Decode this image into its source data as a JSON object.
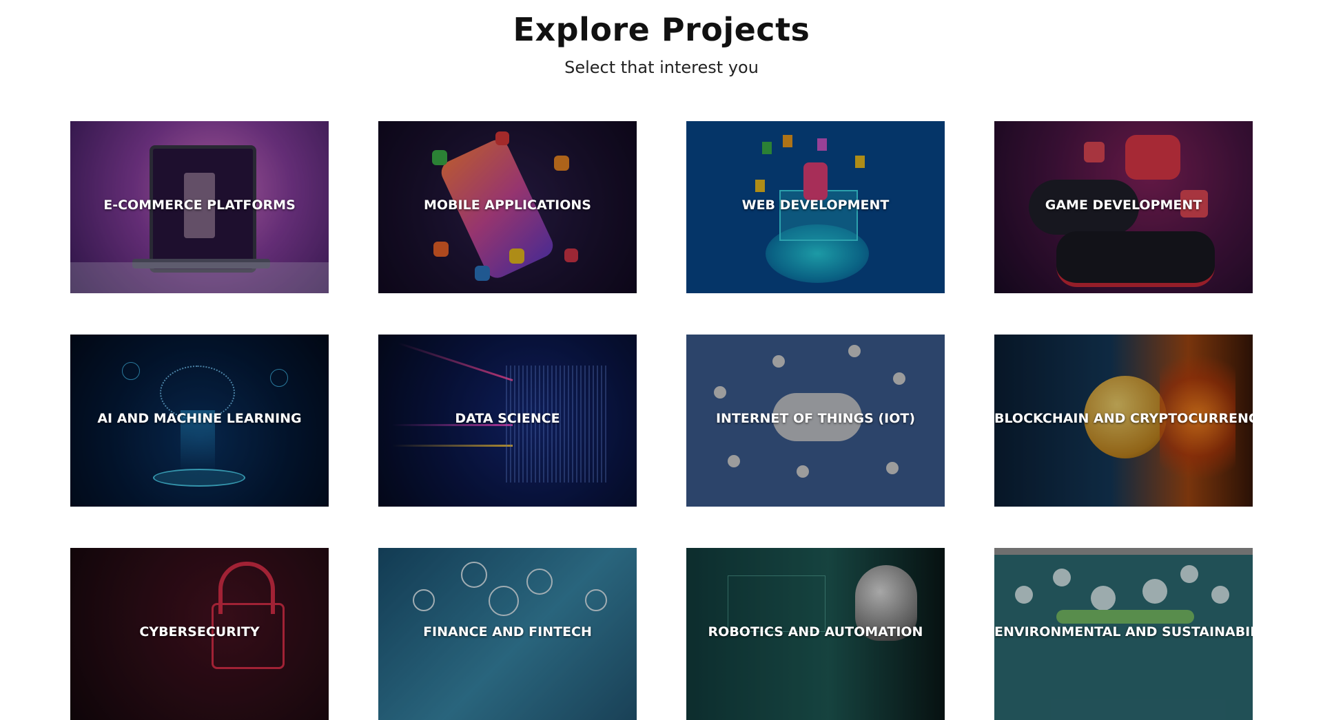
{
  "header": {
    "title": "Explore Projects",
    "subtitle": "Select that interest you"
  },
  "cards": [
    {
      "label": "E-COMMERCE PLATFORMS",
      "icon": "laptop-shopping-bag-icon",
      "colors": [
        "#7a3e9a",
        "#d86ac4",
        "#3b1f5c"
      ]
    },
    {
      "label": "MOBILE APPLICATIONS",
      "icon": "smartphone-apps-icon",
      "colors": [
        "#1f1537",
        "#2b1d47",
        "#130d24"
      ]
    },
    {
      "label": "WEB DEVELOPMENT",
      "icon": "developer-workstation-icon",
      "colors": [
        "#08468c",
        "#0d5aa8",
        "#063a74"
      ]
    },
    {
      "label": "GAME DEVELOPMENT",
      "icon": "gamepad-vr-icon",
      "colors": [
        "#3a0f33",
        "#7d2054",
        "#1a0b26"
      ]
    },
    {
      "label": "AI AND MACHINE LEARNING",
      "icon": "brain-circuit-icon",
      "colors": [
        "#03142e",
        "#06224a",
        "#020b1c"
      ]
    },
    {
      "label": "DATA SCIENCE",
      "icon": "data-streams-icon",
      "colors": [
        "#081233",
        "#10205a",
        "#050b22"
      ]
    },
    {
      "label": "INTERNET OF THINGS (IOT)",
      "icon": "cloud-network-icon",
      "colors": [
        "#3a5a8c",
        "#4a6ea3",
        "#2f4d7b"
      ]
    },
    {
      "label": "BLOCKCHAIN AND CRYPTOCURRENCY",
      "icon": "bitcoin-icon",
      "colors": [
        "#0b1c2e",
        "#7a3a0d",
        "#1c3a5a"
      ]
    },
    {
      "label": "CYBERSECURITY",
      "icon": "padlock-icon",
      "colors": [
        "#2a0d14",
        "#4a1020",
        "#14070c"
      ]
    },
    {
      "label": "FINANCE AND FINTECH",
      "icon": "finance-network-icon",
      "colors": [
        "#1e5f7e",
        "#3a8aa8",
        "#164a63"
      ]
    },
    {
      "label": "ROBOTICS AND AUTOMATION",
      "icon": "robot-icon",
      "colors": [
        "#0f3a3a",
        "#1d5a55",
        "#0a2626"
      ]
    },
    {
      "label": "ENVIRONMENTAL AND SUSTAINABILITY",
      "icon": "eco-network-icon",
      "colors": [
        "#2c6e74",
        "#4f96a0",
        "#245a5f"
      ]
    }
  ]
}
